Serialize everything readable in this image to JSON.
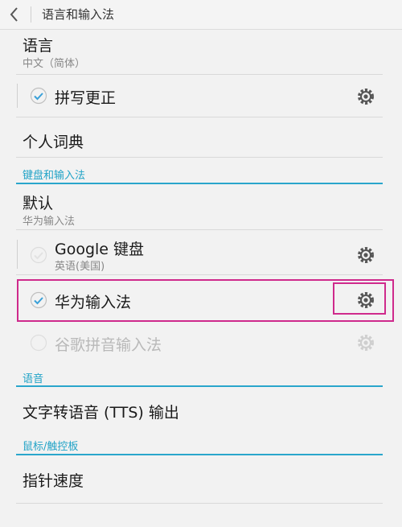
{
  "header": {
    "title": "语言和输入法"
  },
  "language": {
    "label": "语言",
    "value": "中文（简体）"
  },
  "spellcheck": {
    "label": "拼写更正"
  },
  "dictionary": {
    "label": "个人词典"
  },
  "keyboard_section": {
    "title": "键盘和输入法",
    "default_label": "默认",
    "default_value": "华为输入法",
    "methods": [
      {
        "name": "Google 键盘",
        "subtitle": "英语(美国)",
        "checked": false,
        "enabled": true
      },
      {
        "name": "华为输入法",
        "checked": true,
        "enabled": true
      },
      {
        "name": "谷歌拼音输入法",
        "checked": false,
        "enabled": false
      }
    ]
  },
  "speech_section": {
    "title": "语音",
    "tts_label": "文字转语音 (TTS) 输出"
  },
  "pointer_section": {
    "title": "鼠标/触控板",
    "speed_label": "指针速度"
  },
  "colors": {
    "accent": "#2aa6cc",
    "highlight": "#cf2a8c",
    "check": "#3aa0d8"
  }
}
